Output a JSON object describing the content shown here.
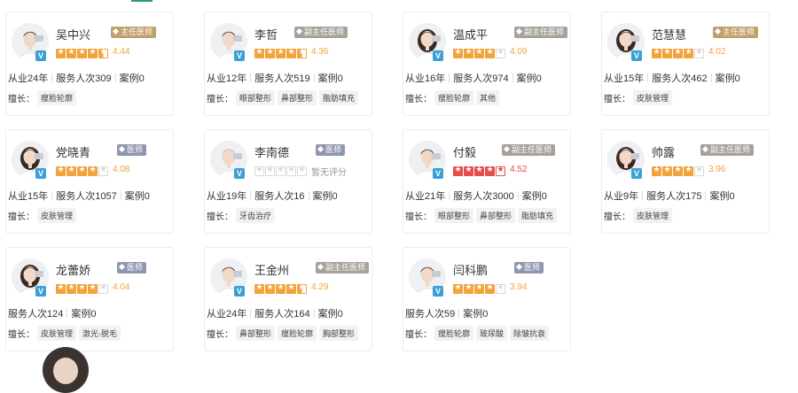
{
  "labels": {
    "specialty_prefix": "擅长："
  },
  "doctors": [
    {
      "name": "吴中兴",
      "title": "主任医师",
      "rating": 4.44,
      "score_text": "4.44",
      "stars": [
        "full",
        "full",
        "full",
        "full",
        "half"
      ],
      "star_color": "orange",
      "stats": [
        "从业24年",
        "服务人次309",
        "案例0"
      ],
      "specialties": [
        "瘦脸轮廓"
      ],
      "avatar": "male-doctor-avatar"
    },
    {
      "name": "李哲",
      "title": "副主任医师",
      "rating": 4.36,
      "score_text": "4.36",
      "stars": [
        "full",
        "full",
        "full",
        "full",
        "half"
      ],
      "star_color": "orange",
      "stats": [
        "从业12年",
        "服务人次519",
        "案例0"
      ],
      "specialties": [
        "眼部整形",
        "鼻部整形",
        "脂肪填充"
      ],
      "avatar": "male-doctor-avatar"
    },
    {
      "name": "温成平",
      "title": "副主任医师",
      "rating": 4.09,
      "score_text": "4.09",
      "stars": [
        "full",
        "full",
        "full",
        "full",
        "empty"
      ],
      "star_color": "orange",
      "stats": [
        "从业16年",
        "服务人次974",
        "案例0"
      ],
      "specialties": [
        "瘦脸轮廓",
        "其他"
      ],
      "avatar": "female-doctor-avatar"
    },
    {
      "name": "范慧慧",
      "title": "主任医师",
      "rating": 4.02,
      "score_text": "4.02",
      "stars": [
        "full",
        "full",
        "full",
        "full",
        "empty"
      ],
      "star_color": "orange",
      "stats": [
        "从业15年",
        "服务人次462",
        "案例0"
      ],
      "specialties": [
        "皮肤管理"
      ],
      "avatar": "female-doctor-avatar"
    },
    {
      "name": "党晓青",
      "title": "医师",
      "rating": 4.08,
      "score_text": "4.08",
      "stars": [
        "full",
        "full",
        "full",
        "full",
        "empty"
      ],
      "star_color": "orange",
      "stats": [
        "从业15年",
        "服务人次1057",
        "案例0"
      ],
      "specialties": [
        "皮肤管理"
      ],
      "avatar": "female-doctor-avatar"
    },
    {
      "name": "李南德",
      "title": "医师",
      "rating": null,
      "score_text": "暂无评分",
      "stars": [
        "empty",
        "empty",
        "empty",
        "empty",
        "empty"
      ],
      "star_color": "gray",
      "stats": [
        "从业19年",
        "服务人次16",
        "案例0"
      ],
      "specialties": [
        "牙齿治疗"
      ],
      "avatar": "senior-doctor-avatar"
    },
    {
      "name": "付毅",
      "title": "副主任医师",
      "rating": 4.52,
      "score_text": "4.52",
      "stars": [
        "full",
        "full",
        "full",
        "full",
        "empty"
      ],
      "star_color": "red",
      "stats": [
        "从业21年",
        "服务人次3000",
        "案例0"
      ],
      "specialties": [
        "眼部整形",
        "鼻部整形",
        "脂肪填充"
      ],
      "avatar": "male-doctor-avatar"
    },
    {
      "name": "帅露",
      "title": "副主任医师",
      "rating": 3.96,
      "score_text": "3.96",
      "stars": [
        "full",
        "full",
        "full",
        "full",
        "empty"
      ],
      "star_color": "orange",
      "stats": [
        "从业9年",
        "服务人次175",
        "案例0"
      ],
      "specialties": [
        "皮肤管理"
      ],
      "avatar": "female-doctor-avatar"
    },
    {
      "name": "龙蕾娇",
      "title": "医师",
      "rating": 4.04,
      "score_text": "4.04",
      "stars": [
        "full",
        "full",
        "full",
        "full",
        "empty"
      ],
      "star_color": "orange",
      "stats": [
        "服务人次124",
        "案例0"
      ],
      "specialties": [
        "皮肤管理",
        "激光-脱毛"
      ],
      "avatar": "female-doctor-avatar"
    },
    {
      "name": "王金州",
      "title": "副主任医师",
      "rating": 4.29,
      "score_text": "4.29",
      "stars": [
        "full",
        "full",
        "full",
        "full",
        "half"
      ],
      "star_color": "orange",
      "stats": [
        "从业24年",
        "服务人次164",
        "案例0"
      ],
      "specialties": [
        "鼻部整形",
        "瘦脸轮廓",
        "胸部整形"
      ],
      "avatar": "male-doctor-avatar"
    },
    {
      "name": "闫科鹏",
      "title": "医师",
      "rating": 3.94,
      "score_text": "3.94",
      "stars": [
        "full",
        "full",
        "full",
        "full",
        "empty"
      ],
      "star_color": "orange",
      "stats": [
        "服务人次59",
        "案例0"
      ],
      "specialties": [
        "瘦脸轮廓",
        "玻尿酸",
        "除皱抗衰"
      ],
      "avatar": "male-doctor-avatar"
    }
  ],
  "colors": {
    "star": "#f2a33a",
    "star_red": "#e84b4b",
    "badge_main": "#c1a06b",
    "badge_deputy": "#a7a19a",
    "badge_doctor": "#8f96b0",
    "verified": "#3aa0d6",
    "accent": "#2d9b6e"
  }
}
